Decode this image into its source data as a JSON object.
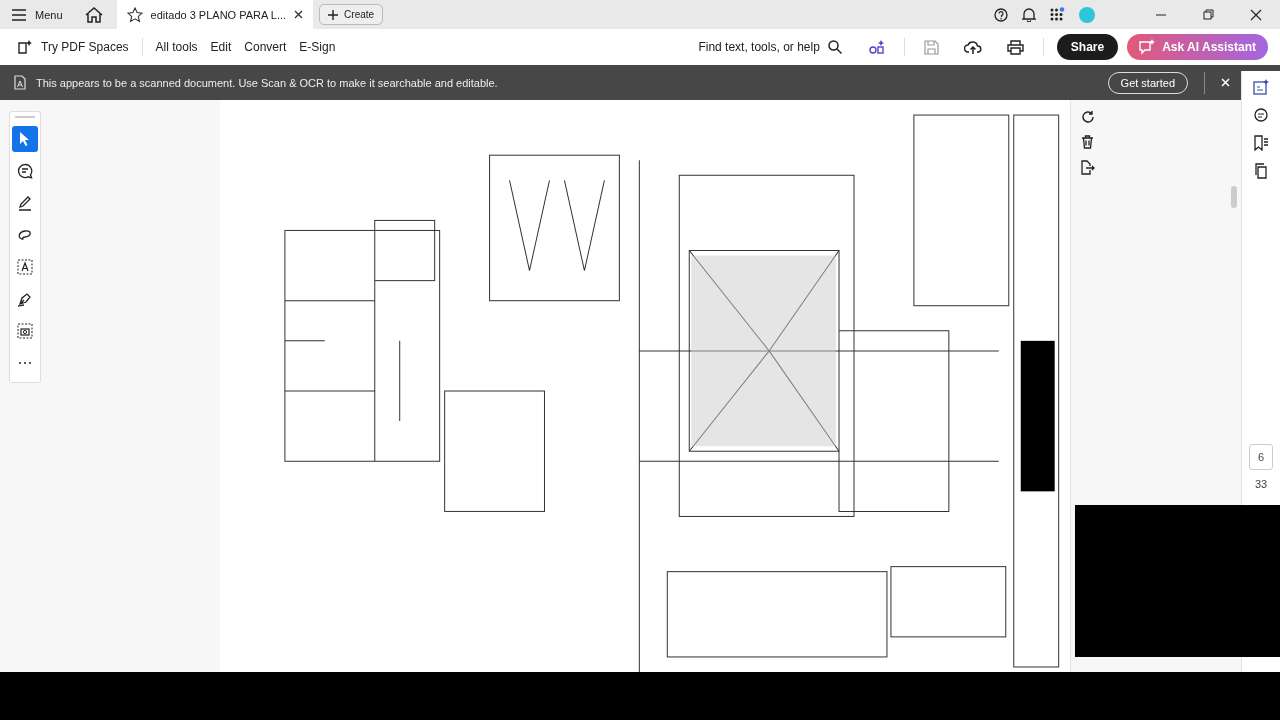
{
  "title_bar": {
    "menu_label": "Menu",
    "tab_title": "editado 3 PLANO PARA L...",
    "create_label": "Create"
  },
  "toolbar": {
    "spaces_label": "Try PDF Spaces",
    "menu_items": [
      "All tools",
      "Edit",
      "Convert",
      "E-Sign"
    ],
    "search_label": "Find text, tools, or help",
    "share_label": "Share",
    "ai_label": "Ask AI Assistant"
  },
  "banner": {
    "message": "This appears to be a scanned document. Use Scan & OCR to make it searchable and editable.",
    "action": "Get started"
  },
  "tools": [
    {
      "kind": "select",
      "selected": true
    },
    {
      "kind": "comment",
      "selected": false
    },
    {
      "kind": "draw",
      "selected": false
    },
    {
      "kind": "lasso",
      "selected": false
    },
    {
      "kind": "text",
      "selected": false
    },
    {
      "kind": "sign",
      "selected": false
    },
    {
      "kind": "snapshot",
      "selected": false
    },
    {
      "kind": "more",
      "selected": false
    }
  ],
  "page_nav": {
    "current": "6",
    "total": "33"
  }
}
